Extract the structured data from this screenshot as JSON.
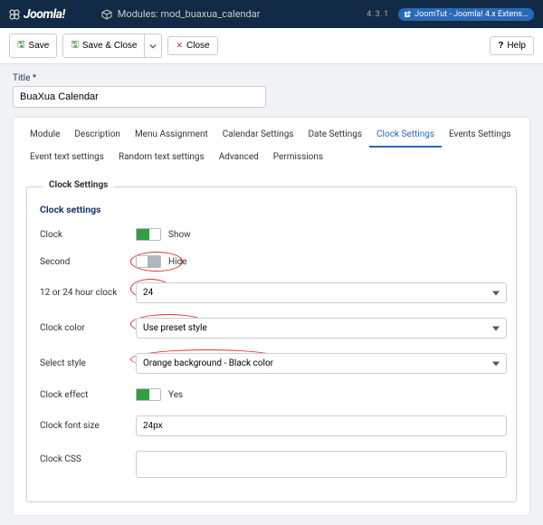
{
  "topbar": {
    "brand": "Joomla!",
    "module_icon": "cube-icon",
    "module_label": "Modules: mod_buaxua_calendar",
    "version": "4.3.1",
    "ext_badge": "JoomTut - Joomla! 4.x Extens..."
  },
  "toolbar": {
    "save": "Save",
    "save_close": "Save & Close",
    "close": "Close",
    "help": "Help"
  },
  "title": {
    "label": "Title *",
    "value": "BuaXua Calendar"
  },
  "tabs": {
    "items": [
      "Module",
      "Description",
      "Menu Assignment",
      "Calendar Settings",
      "Date Settings",
      "Clock Settings",
      "Events Settings",
      "Event text settings",
      "Random text settings",
      "Advanced",
      "Permissions"
    ],
    "active": "Clock Settings"
  },
  "fieldset": {
    "legend": "Clock Settings",
    "heading": "Clock settings"
  },
  "fields": {
    "clock": {
      "label": "Clock",
      "state_text": "Show"
    },
    "second": {
      "label": "Second",
      "state_text": "Hide"
    },
    "hour_mode": {
      "label": "12 or 24 hour clock",
      "value": "24"
    },
    "clock_color": {
      "label": "Clock color",
      "value": "Use preset style"
    },
    "select_style": {
      "label": "Select style",
      "value": "Orange background - Black color"
    },
    "clock_effect": {
      "label": "Clock effect",
      "state_text": "Yes"
    },
    "font_size": {
      "label": "Clock font size",
      "value": "24px"
    },
    "clock_css": {
      "label": "Clock CSS",
      "value": ""
    }
  }
}
